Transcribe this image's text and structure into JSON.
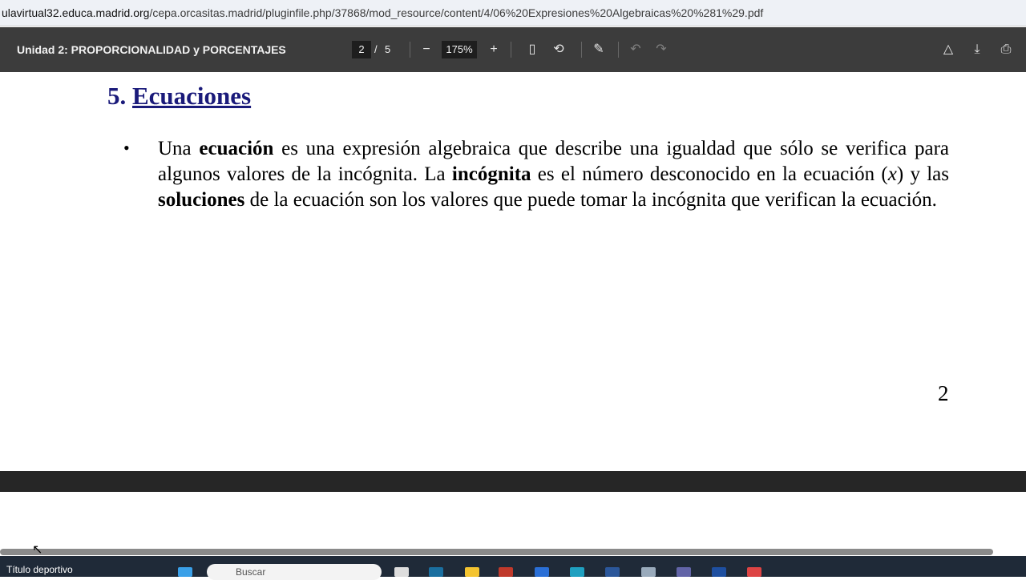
{
  "browser": {
    "url_host": "ulavirtual32.educa.madrid.org",
    "url_path": "/cepa.orcasitas.madrid/pluginfile.php/37868/mod_resource/content/4/06%20Expresiones%20Algebraicas%20%281%29.pdf"
  },
  "viewer": {
    "title": "Unidad 2: PROPORCIONALIDAD y PORCENTAJES",
    "current_page": "2",
    "separator": "/",
    "total_pages": "5",
    "zoom": "175%"
  },
  "document": {
    "heading_number": "5.",
    "heading": "Ecuaciones",
    "bullet": "•",
    "para": [
      {
        "t": "Una ",
        "b": false
      },
      {
        "t": "ecuación",
        "b": true
      },
      {
        "t": " es una expresión algebraica que describe una igualdad que sólo se verifica para algunos valores de la incógnita. La ",
        "b": false
      },
      {
        "t": "incógnita",
        "b": true
      },
      {
        "t": " es el número desconocido en la ecuación (",
        "b": false
      },
      {
        "t": "x",
        "i": true
      },
      {
        "t": ") y las ",
        "b": false
      },
      {
        "t": "soluciones",
        "b": true
      },
      {
        "t": " de la ecuación son los valores que puede tomar la incógnita que verifican la ecuación.",
        "b": false
      }
    ],
    "page_number": "2"
  },
  "taskbar": {
    "status_text": "Título deportivo",
    "search_placeholder": "Buscar"
  }
}
